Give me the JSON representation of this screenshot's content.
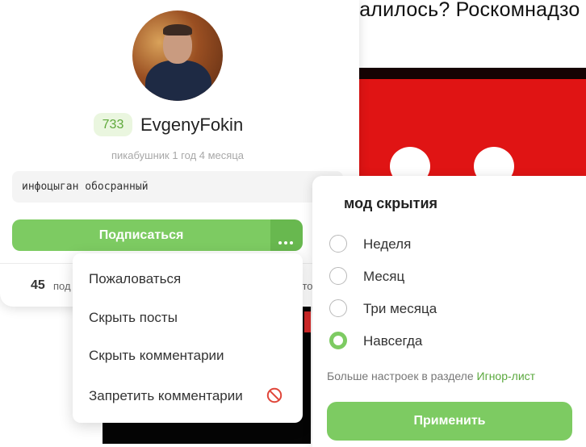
{
  "article": {
    "title_fragment": "валилось? Роскомнадзо"
  },
  "profile": {
    "rating": "733",
    "username": "EvgenyFokin",
    "member_since": "пикабушник 1 год 4 месяца",
    "bio": "инфоцыган обосранный",
    "subscribe_label": "Подписаться",
    "stats": {
      "subscribers_count": "45",
      "subscribers_label_fragment": "под",
      "posts_label_fragment": "стов"
    }
  },
  "menu": {
    "items": [
      {
        "label": "Пожаловаться"
      },
      {
        "label": "Скрыть посты"
      },
      {
        "label": "Скрыть комментарии"
      },
      {
        "label": "Запретить комментарии"
      }
    ]
  },
  "hide_panel": {
    "title_fragment": "мод скрытия",
    "options": [
      {
        "label": "Неделя",
        "selected": false
      },
      {
        "label": "Месяц",
        "selected": false
      },
      {
        "label": "Три месяца",
        "selected": false
      },
      {
        "label": "Навсегда",
        "selected": true
      }
    ],
    "more_settings_text": "Больше настроек в разделе ",
    "ignore_list_link": "Игнор-лист",
    "apply_label": "Применить"
  },
  "colors": {
    "accent_green": "#7dcb62",
    "accent_green_dark": "#68b84f",
    "link_green": "#5aa83d",
    "ban_red": "#e0463a",
    "bg_image_red": "#e01414"
  }
}
